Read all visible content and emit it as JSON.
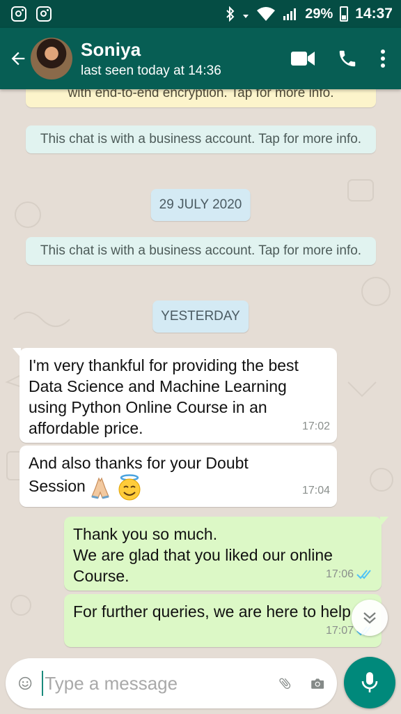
{
  "status_bar": {
    "battery": "29%",
    "time": "14:37"
  },
  "header": {
    "contact_name": "Soniya",
    "last_seen": "last seen today at 14:36"
  },
  "chat": {
    "encryption_notice": "with end-to-end encryption. Tap for more info.",
    "business_notice_1": "This chat is with a business account. Tap for more info.",
    "date_1": "29 JULY 2020",
    "business_notice_2": "This chat is with a business account. Tap for more info.",
    "date_2": "YESTERDAY",
    "messages": [
      {
        "direction": "incoming",
        "text": "I'm very thankful for providing the best Data Science and Machine Learning using Python Online Course in an affordable price.",
        "time": "17:02"
      },
      {
        "direction": "incoming",
        "text": "And also thanks for your Doubt Session",
        "emojis": [
          "folded-hands",
          "smiling-face-with-halo"
        ],
        "time": "17:04"
      },
      {
        "direction": "outgoing",
        "text_lines": [
          "Thank you so much.",
          "We are glad that you  liked our online Course."
        ],
        "time": "17:06",
        "status": "read"
      },
      {
        "direction": "outgoing",
        "text": "For further queries, we are here to help",
        "time": "17:07",
        "status": "read"
      }
    ]
  },
  "composer": {
    "placeholder": "Type a message"
  },
  "colors": {
    "header": "#075e54",
    "status_bar": "#054d44",
    "outgoing_bubble": "#dcf8c6",
    "chat_background": "#e5ddd5",
    "read_ticks": "#4fc3f7",
    "accent": "#00897b"
  }
}
